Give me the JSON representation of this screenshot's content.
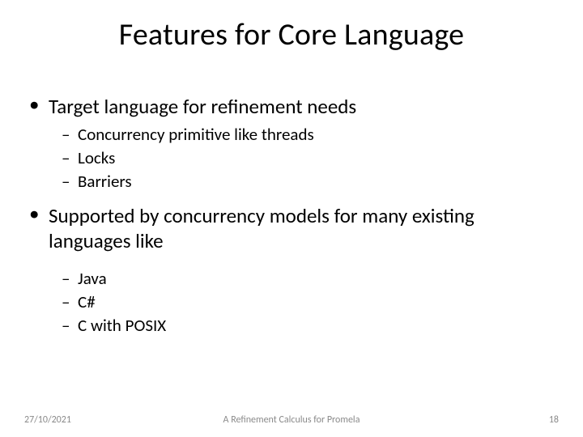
{
  "title": "Features for Core Language",
  "bullets": {
    "b1a": "Target language for refinement needs",
    "b1a_sub": {
      "s1": "Concurrency primitive like threads",
      "s2": "Locks",
      "s3": "Barriers"
    },
    "b1b": "Supported by concurrency models for many existing languages like",
    "b1b_sub": {
      "s1": "Java",
      "s2": "C#",
      "s3": "C with POSIX"
    }
  },
  "footer": {
    "date": "27/10/2021",
    "mid": "A Refinement Calculus for Promela",
    "page": "18"
  }
}
